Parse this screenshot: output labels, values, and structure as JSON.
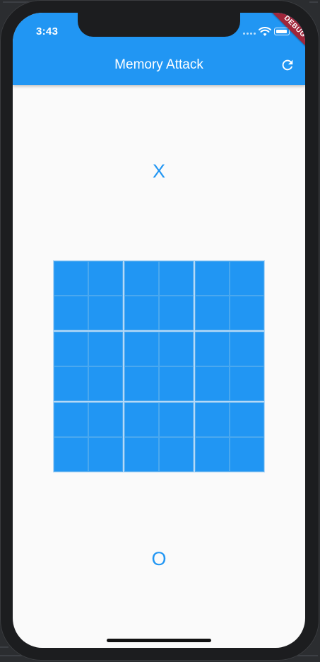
{
  "status_bar": {
    "time": "3:43",
    "debug_banner": "DEBUG"
  },
  "app_bar": {
    "title": "Memory Attack",
    "refresh_icon": "refresh-icon"
  },
  "players": {
    "top": "X",
    "bottom": "O"
  },
  "board": {
    "blocks": 9,
    "cells_per_block": 4,
    "cell_color": "#2196f3"
  },
  "colors": {
    "accent": "#2196f3",
    "background": "#fafafa",
    "debug": "#a0263a"
  }
}
